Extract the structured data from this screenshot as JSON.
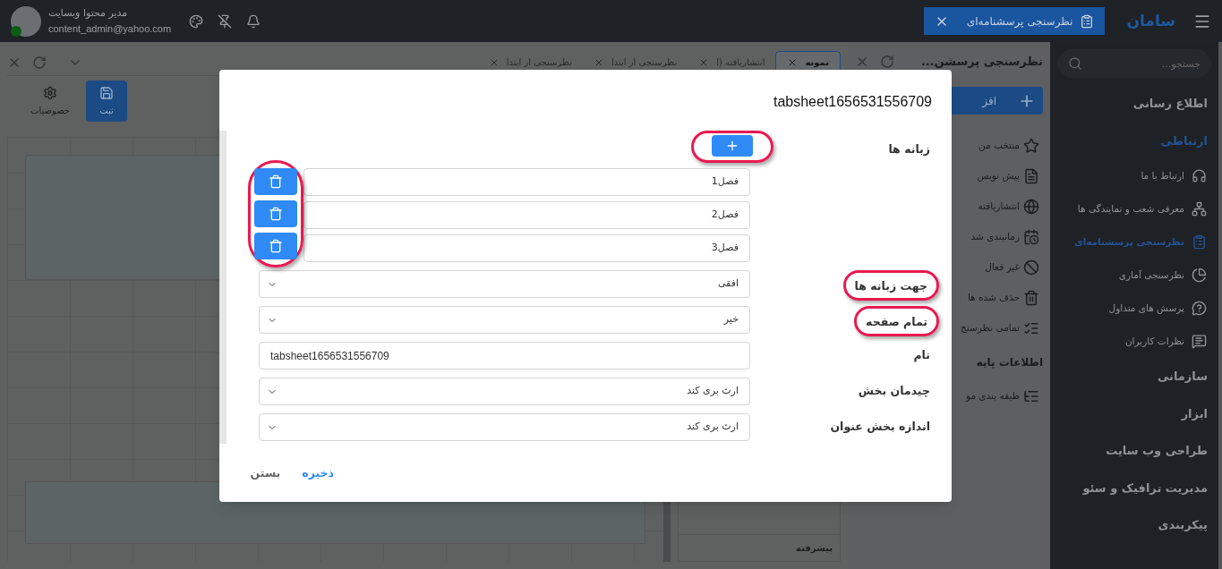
{
  "topbar": {
    "logo": "سامان",
    "open_tab": {
      "label": "نظرسنجی پرسشنامه‌ای"
    },
    "user": {
      "name": "مدیر محتوا وبسایت",
      "email": "content_admin@yahoo.com",
      "online": true
    }
  },
  "sidebar": {
    "search": {
      "placeholder": "جستجو..."
    },
    "sections": [
      {
        "label": "اطلاع رسانی",
        "selected": false
      },
      {
        "label": "ارتباطی",
        "selected": true,
        "children": [
          {
            "label": "ارتباط با ما",
            "selected": false
          },
          {
            "label": "معرفی شعب و نمایندگی ها",
            "selected": false
          },
          {
            "label": "نظرسنجی پرسشنامه‌ای",
            "selected": true
          },
          {
            "label": "نظرسنجی آماری",
            "selected": false
          },
          {
            "label": "پرسش های متداول",
            "selected": false
          },
          {
            "label": "نظرات کاربران",
            "selected": false
          }
        ]
      },
      {
        "label": "سازمانی",
        "selected": false
      },
      {
        "label": "ابزار",
        "selected": false
      },
      {
        "label": "طراحی وب سایت",
        "selected": false
      },
      {
        "label": "مدیریت ترافیک و سئو",
        "selected": false
      },
      {
        "label": "پیکربندی",
        "selected": false
      }
    ]
  },
  "panel": {
    "title": "نظرسنجی پرسشن...",
    "add_button": "افز",
    "groups": [
      {
        "items": [
          {
            "label": "منتخب من"
          },
          {
            "label": "پیش نویس"
          },
          {
            "label": "انتشاریافته"
          },
          {
            "label": "زمانبندی شد"
          },
          {
            "label": "غیر فعال"
          },
          {
            "label": "حذف شده ها"
          },
          {
            "label": "تمامی نظرسنج"
          }
        ]
      },
      {
        "heading": "اطلاعات پایه",
        "items": [
          {
            "label": "طبقه بندی مو"
          }
        ]
      }
    ]
  },
  "editor": {
    "tabs": [
      {
        "label": "نمونه",
        "selected": true
      },
      {
        "label": "انتشاریافته (ا",
        "selected": false
      },
      {
        "label": "نظرسنجی از ابتدا",
        "selected": false
      },
      {
        "label": "نظرسنجی از ابتدا",
        "selected": false
      }
    ],
    "toolbar": [
      {
        "label": "ثبت",
        "kind": "primary"
      },
      {
        "label": "خصوصیات",
        "kind": "plain"
      }
    ],
    "side_panel": {
      "label": "پیشرفته"
    }
  },
  "dialog": {
    "title": "tabsheet1656531556709",
    "fields": [
      {
        "kind": "tabs",
        "label": "زبانه ها",
        "highlighted": false,
        "add_highlighted": true,
        "items_highlighted": true,
        "items": [
          {
            "value": "فصل1"
          },
          {
            "value": "فصل2"
          },
          {
            "value": "فصل3"
          }
        ]
      },
      {
        "kind": "select",
        "label": "جهت زبانه ها",
        "value": "افقی",
        "highlighted": true
      },
      {
        "kind": "select",
        "label": "تمام صفحه",
        "value": "خیر",
        "highlighted": true
      },
      {
        "kind": "text",
        "label": "نام",
        "value": "tabsheet1656531556709",
        "highlighted": false
      },
      {
        "kind": "select",
        "label": "چیدمان بخش",
        "value": "ارث بری کند",
        "highlighted": false
      },
      {
        "kind": "select",
        "label": "اندازه بخش عنوان",
        "value": "ارث بری کند",
        "highlighted": false
      }
    ],
    "buttons": [
      {
        "label": "ذخیره",
        "kind": "primary"
      },
      {
        "label": "بستن",
        "kind": "secondary"
      }
    ]
  }
}
